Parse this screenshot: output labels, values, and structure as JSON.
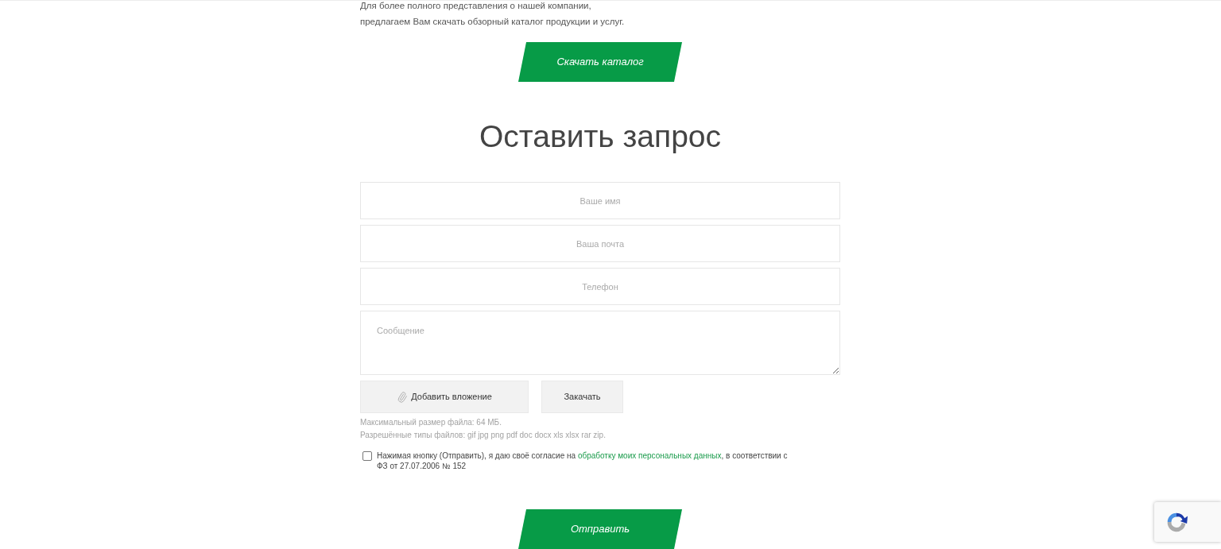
{
  "intro": {
    "lines": [
      "Для более полного представления о нашей компании,",
      "предлагаем Вам скачать обзорный каталог продукции и услуг."
    ]
  },
  "catalog_button": {
    "label": "Скачать каталог"
  },
  "heading": "Оставить запрос",
  "form": {
    "fields": [
      {
        "kind": "input",
        "placeholder": "Ваше имя"
      },
      {
        "kind": "input",
        "placeholder": "Ваша почта"
      },
      {
        "kind": "input",
        "placeholder": "Телефон"
      },
      {
        "kind": "textarea",
        "placeholder": "Сообщение"
      }
    ],
    "attach_button": {
      "label": "Добавить вложение"
    },
    "upload_button": {
      "label": "Закачать"
    },
    "hints": [
      "Максимальный размер файла: 64 МБ.",
      "Разрешённые типы файлов: gif jpg png pdf doc docx xls xlsx rar zip."
    ],
    "consent": {
      "checked": false,
      "text_before": "Нажимая кнопку (Отправить), я даю своё согласие на ",
      "link": "обработку моих персональных данных",
      "text_after": ", в соответствии с ФЗ от 27.07.2006 № 152"
    },
    "submit_button": {
      "label": "Отправить"
    }
  }
}
